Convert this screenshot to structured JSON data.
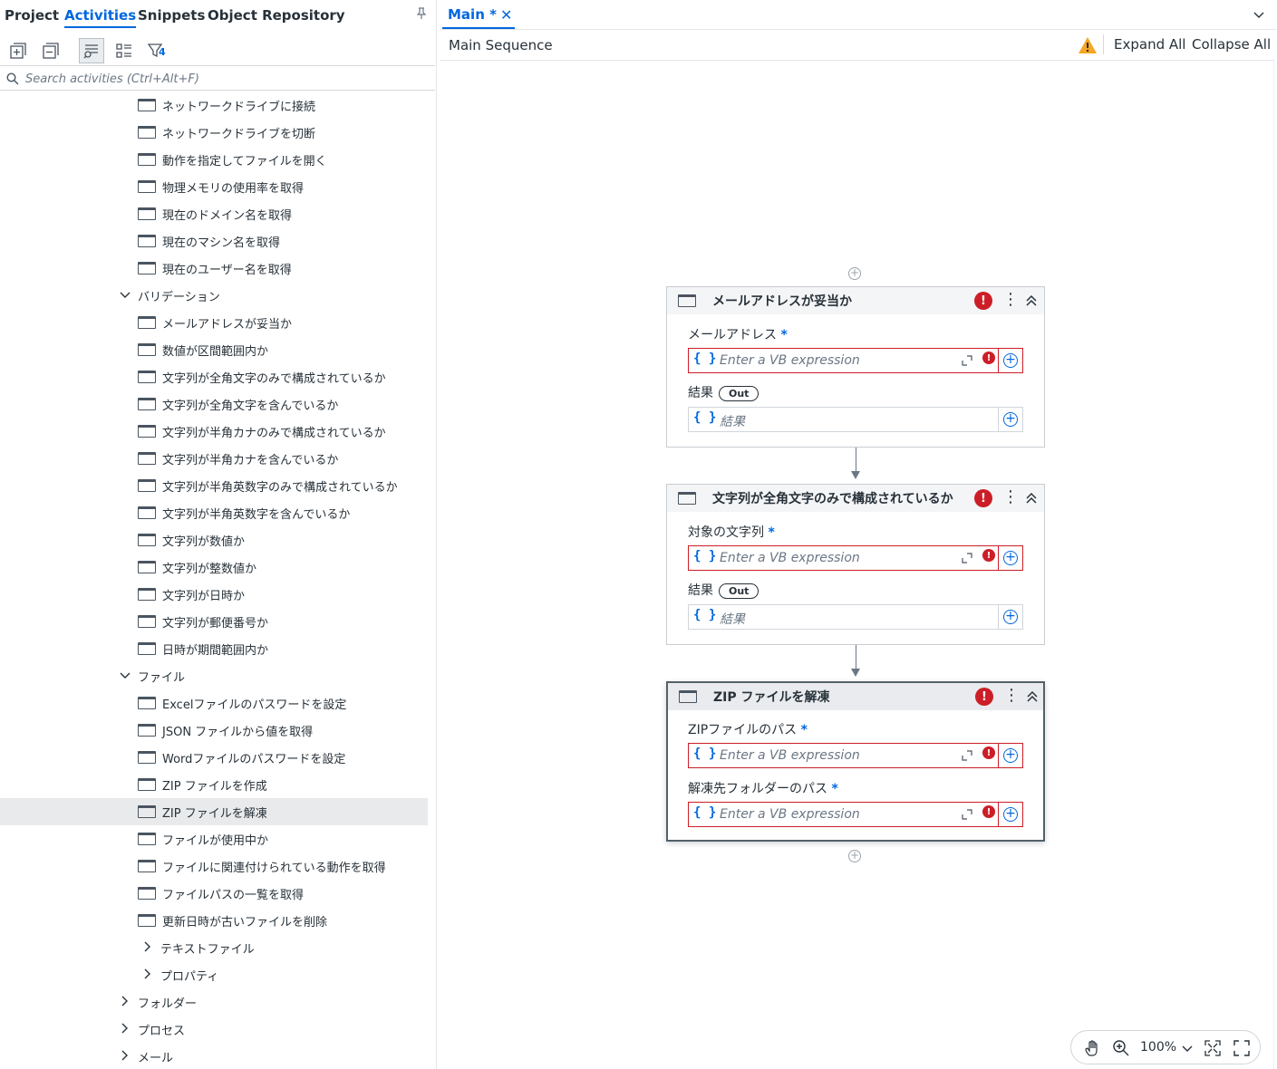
{
  "left_panel": {
    "tabs": [
      {
        "label": "Project"
      },
      {
        "label": "Activities"
      },
      {
        "label": "Snippets"
      },
      {
        "label": "Object Repository"
      }
    ],
    "filter_count": "4",
    "search_placeholder": "Search activities (Ctrl+Alt+F)",
    "tree": [
      {
        "type": "activity",
        "label": "ネットワークドライブに接続"
      },
      {
        "type": "activity",
        "label": "ネットワークドライブを切断"
      },
      {
        "type": "activity",
        "label": "動作を指定してファイルを開く"
      },
      {
        "type": "activity",
        "label": "物理メモリの使用率を取得"
      },
      {
        "type": "activity",
        "label": "現在のドメイン名を取得"
      },
      {
        "type": "activity",
        "label": "現在のマシン名を取得"
      },
      {
        "type": "activity",
        "label": "現在のユーザー名を取得"
      },
      {
        "type": "category-open",
        "label": "バリデーション"
      },
      {
        "type": "activity",
        "label": "メールアドレスが妥当か"
      },
      {
        "type": "activity",
        "label": "数値が区間範囲内か"
      },
      {
        "type": "activity",
        "label": "文字列が全角文字のみで構成されているか"
      },
      {
        "type": "activity",
        "label": "文字列が全角文字を含んでいるか"
      },
      {
        "type": "activity",
        "label": "文字列が半角カナのみで構成されているか"
      },
      {
        "type": "activity",
        "label": "文字列が半角カナを含んでいるか"
      },
      {
        "type": "activity",
        "label": "文字列が半角英数字のみで構成されているか"
      },
      {
        "type": "activity",
        "label": "文字列が半角英数字を含んでいるか"
      },
      {
        "type": "activity",
        "label": "文字列が数値か"
      },
      {
        "type": "activity",
        "label": "文字列が整数値か"
      },
      {
        "type": "activity",
        "label": "文字列が日時か"
      },
      {
        "type": "activity",
        "label": "文字列が郵便番号か"
      },
      {
        "type": "activity",
        "label": "日時が期間範囲内か"
      },
      {
        "type": "category-open",
        "label": "ファイル"
      },
      {
        "type": "activity",
        "label": "Excelファイルのパスワードを設定"
      },
      {
        "type": "activity",
        "label": "JSON ファイルから値を取得"
      },
      {
        "type": "activity",
        "label": "Wordファイルのパスワードを設定"
      },
      {
        "type": "activity",
        "label": "ZIP ファイルを作成"
      },
      {
        "type": "activity",
        "label": "ZIP ファイルを解凍",
        "selected": true
      },
      {
        "type": "activity",
        "label": "ファイルが使用中か"
      },
      {
        "type": "activity",
        "label": "ファイルに関連付けられている動作を取得"
      },
      {
        "type": "activity",
        "label": "ファイルパスの一覧を取得"
      },
      {
        "type": "activity",
        "label": "更新日時が古いファイルを削除"
      },
      {
        "type": "subcategory-closed",
        "label": "テキストファイル"
      },
      {
        "type": "subcategory-closed",
        "label": "プロパティ"
      },
      {
        "type": "category-closed",
        "label": "フォルダー"
      },
      {
        "type": "category-closed",
        "label": "プロセス"
      },
      {
        "type": "category-closed",
        "label": "メール"
      }
    ]
  },
  "editor": {
    "doc_tab": "Main *",
    "breadcrumb": "Main Sequence",
    "expand_all": "Expand All",
    "collapse_all": "Collapse All",
    "zoom": "100%",
    "cards": [
      {
        "title": "メールアドレスが妥当か",
        "fields": [
          {
            "label": "メールアドレス",
            "required": "*",
            "placeholder": "Enter a VB expression",
            "error": true
          },
          {
            "label": "結果",
            "out": "Out",
            "placeholder": "結果",
            "error": false
          }
        ]
      },
      {
        "title": "文字列が全角文字のみで構成されているか",
        "fields": [
          {
            "label": "対象の文字列",
            "required": "*",
            "placeholder": "Enter a VB expression",
            "error": true
          },
          {
            "label": "結果",
            "out": "Out",
            "placeholder": "結果",
            "error": false
          }
        ]
      },
      {
        "title": "ZIP ファイルを解凍",
        "selected": true,
        "fields": [
          {
            "label": "ZIPファイルのパス",
            "required": "*",
            "placeholder": "Enter a VB expression",
            "error": true
          },
          {
            "label": "解凍先フォルダーのパス",
            "required": "*",
            "placeholder": "Enter a VB expression",
            "error": true
          }
        ]
      }
    ],
    "error_glyph": "!",
    "kebab_glyph": "⋮",
    "braces_glyph": "{ }",
    "plus_glyph": "+"
  },
  "colors": {
    "accent": "#0067df",
    "error": "#cc1e27",
    "warning": "#f5a623",
    "selected_row": "#e9eaeb"
  }
}
